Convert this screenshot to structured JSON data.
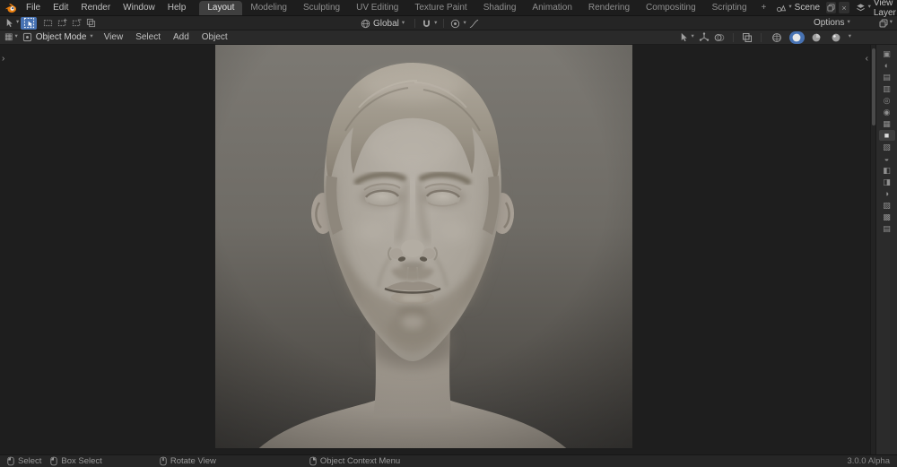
{
  "topbar": {
    "menus": [
      "File",
      "Edit",
      "Render",
      "Window",
      "Help"
    ],
    "workspaces": [
      "Layout",
      "Modeling",
      "Sculpting",
      "UV Editing",
      "Texture Paint",
      "Shading",
      "Animation",
      "Rendering",
      "Compositing",
      "Scripting"
    ],
    "add_workspace": "+",
    "scene_selector": {
      "label": "Scene"
    },
    "view_layer_selector": {
      "label": "View Layer"
    }
  },
  "tool_settings": {
    "orientation_label": "Global",
    "options_label": "Options"
  },
  "viewport": {
    "header": {
      "mode": "Object Mode",
      "menus": [
        "View",
        "Select",
        "Add",
        "Object"
      ]
    }
  },
  "status_bar": {
    "items": [
      "Select",
      "Box Select",
      "Rotate View",
      "Object Context Menu"
    ],
    "version": "3.0.0 Alpha"
  },
  "colors": {
    "accent_blue": "#4772b3",
    "topbar_bg": "#1d1d1d",
    "viewport_bg": "#1e1e1e",
    "camera_bg_top": "#7c7973",
    "camera_bg_bottom": "#454340",
    "clay": "#a9a399"
  }
}
